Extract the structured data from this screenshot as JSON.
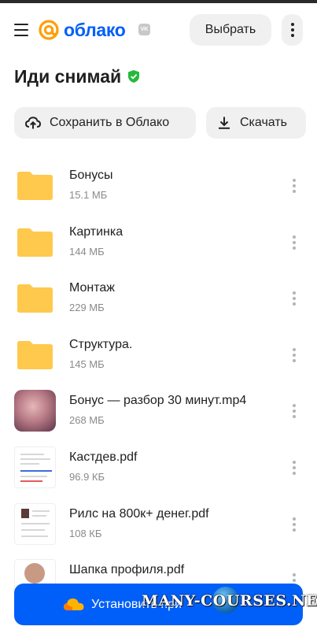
{
  "header": {
    "logo_text": "облако",
    "vk_badge": "VK",
    "select_label": "Выбрать",
    "menu_icon": "hamburger-icon",
    "more_icon": "more-vertical-icon"
  },
  "page": {
    "title": "Иди снимай",
    "verified_icon": "shield-check-icon"
  },
  "actions": {
    "save_label": "Сохранить в Облако",
    "download_label": "Скачать"
  },
  "files": [
    {
      "name": "Бонусы",
      "size": "15.1 МБ",
      "type": "folder"
    },
    {
      "name": "Картинка",
      "size": "144 МБ",
      "type": "folder"
    },
    {
      "name": "Монтаж",
      "size": "229 МБ",
      "type": "folder"
    },
    {
      "name": "Структура.",
      "size": "145 МБ",
      "type": "folder"
    },
    {
      "name": "Бонус — разбор 30 минут.mp4",
      "size": "268 МБ",
      "type": "video"
    },
    {
      "name": "Кастдев.pdf",
      "size": "96.9 КБ",
      "type": "pdf"
    },
    {
      "name": "Рилс на 800к+ денег.pdf",
      "size": "108 КБ",
      "type": "pdf"
    },
    {
      "name": "Шапка профиля.pdf",
      "size": "",
      "type": "pdf"
    }
  ],
  "banner": {
    "install_text": "Установить при",
    "watermark": "MANY-COURSES.NET"
  },
  "colors": {
    "brand": "#005ff9",
    "folder": "#ffc94d",
    "verified": "#25b93b"
  }
}
